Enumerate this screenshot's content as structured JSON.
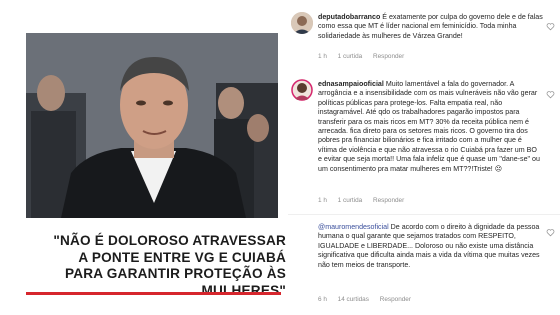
{
  "article": {
    "quote": "\"NÃO É DOLOROSO ATRAVESSAR A PONTE ENTRE VG E CUIABÁ PARA GARANTIR PROTEÇÃO ÀS MULHERES\"",
    "accent_color": "#d6262d"
  },
  "comments": [
    {
      "username": "deputadobarranco",
      "text": "É exatamente por culpa do governo dele e de falas como essa que MT é líder nacional em feminicídio. Toda minha solidariedade às mulheres de Várzea Grande!",
      "time": "1 h",
      "likes": "1 curtida",
      "reply": "Responder"
    },
    {
      "username": "ednasampaiooficial",
      "text": "Muito lamentável a fala do governador. A arrogância e a insensibilidade com os mais vulneráveis não vão gerar políticas públicas para protege-los. Falta empatia real, não instagramável. Até qdo os trabalhadores pagarão impostos para transferir para os mais ricos em MT? 30% da receita pública nem é arrecada. fica direto para os setores mais ricos. O governo tira dos pobres pra financiar bilionários e fica irritado com a mulher que é vítima de violência e que não atravessa o rio Cuiabá pra fazer um BO e evitar que seja morta!! Uma fala infeliz que é quase um \"dane-se\" ou um consentimento pra matar mulheres em MT??!Triste! ☹",
      "time": "1 h",
      "likes": "1 curtida",
      "reply": "Responder"
    },
    {
      "mention": "@mauromendesoficial",
      "text": "De acordo com o direito à dignidade da pessoa humana o qual garante que sejamos tratados com RESPEITO, IGUALDADE e LIBERDADE... Doloroso ou não existe uma distância significativa que dificulta ainda mais a vida da vítima que muitas vezes não tem meios de transporte.",
      "time": "6 h",
      "likes": "14 curtidas",
      "reply": "Responder"
    }
  ],
  "icons": {
    "like": "heart-outline-icon"
  }
}
